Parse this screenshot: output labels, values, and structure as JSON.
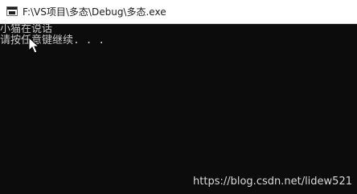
{
  "window": {
    "title": "F:\\VS项目\\多态\\Debug\\多态.exe",
    "icon": "console-app-icon"
  },
  "console": {
    "lines": [
      "小猫在说话",
      "请按任意键继续. . ."
    ],
    "pointer": "mouse-pointer-icon"
  },
  "watermark": {
    "text": "https://blog.csdn.net/lidew521"
  },
  "colors": {
    "console_background": "#0c0c0c",
    "console_text": "#c8c8c8",
    "titlebar_background": "#ffffff"
  }
}
